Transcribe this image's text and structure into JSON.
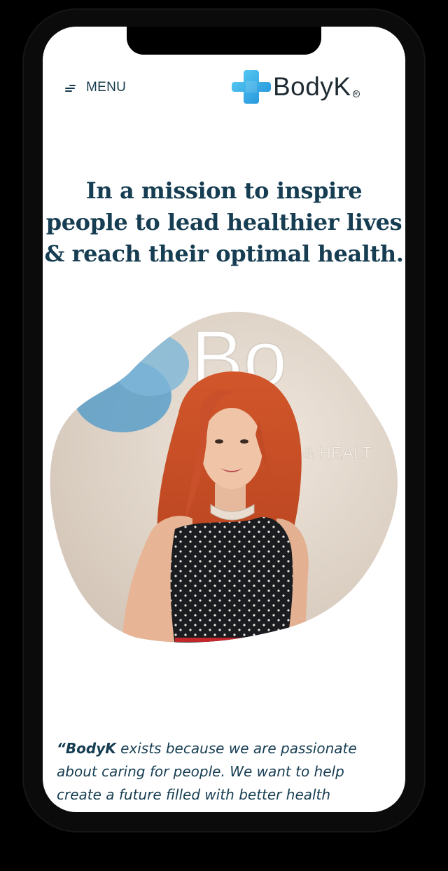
{
  "header": {
    "menu_label": "MENU",
    "menu_icon": "hamburger-menu-icon",
    "logo_text": "BodyK",
    "logo_registered": "R",
    "logo_icon": "medical-cross-icon"
  },
  "hero": {
    "headline_lines": [
      "In a mission to inspire",
      "people to lead healthier lives",
      "& reach their optimal health."
    ],
    "photo_sign_partial_1": "Bo",
    "photo_sign_partial_2": "NESS & HEALT"
  },
  "quote": {
    "open_mark": "“",
    "brand": "BodyK",
    "line1_rest": " exists because we are passionate",
    "line2": "about caring for people. We want to help",
    "line3": "create a future filled with better health"
  },
  "colors": {
    "heading": "#163d52",
    "brand_blue": "#2fa6e0",
    "background": "#ffffff"
  }
}
